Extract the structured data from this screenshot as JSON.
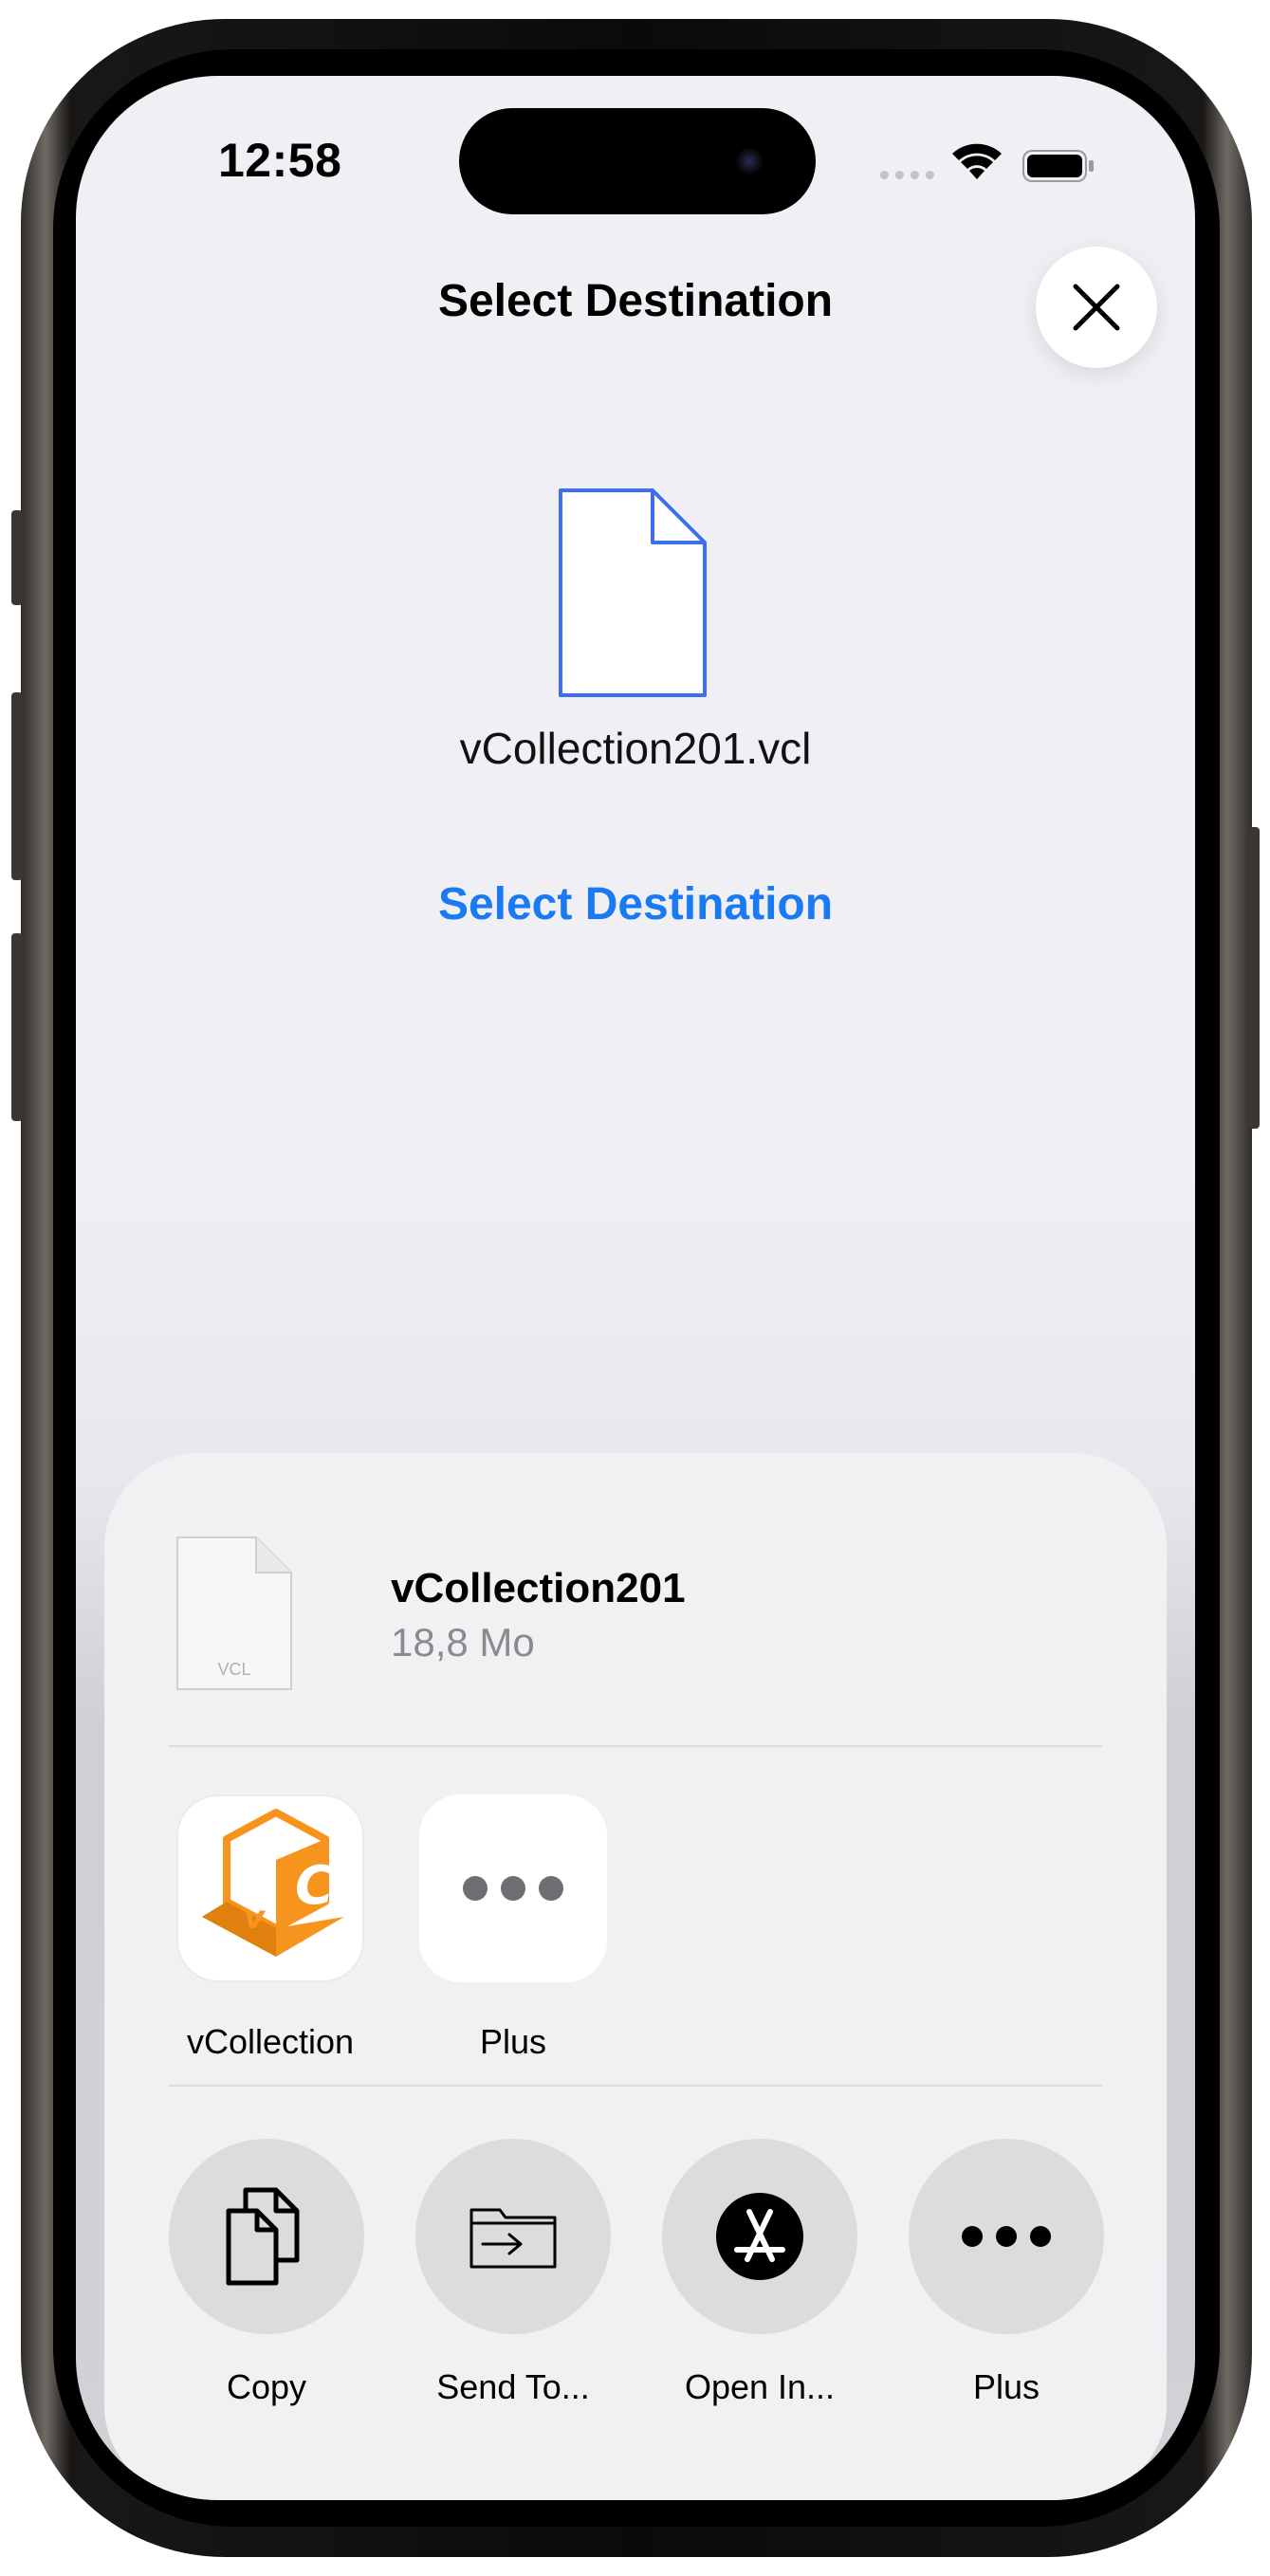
{
  "status_bar": {
    "time": "12:58"
  },
  "header": {
    "title": "Select Destination",
    "close_icon": "close-icon"
  },
  "file": {
    "name": "vCollection201.vcl",
    "select_destination_label": "Select Destination"
  },
  "share_sheet": {
    "document": {
      "name": "vCollection201",
      "size": "18,8 Mo",
      "thumb_label": "VCL"
    },
    "apps": [
      {
        "label": "vCollection",
        "icon": "vcollection-app-icon",
        "brand_color": "#f7941d"
      },
      {
        "label": "Plus",
        "icon": "more-icon"
      }
    ],
    "actions": [
      {
        "label": "Copy",
        "icon": "copy-icon"
      },
      {
        "label": "Send To...",
        "icon": "send-to-folder-icon"
      },
      {
        "label": "Open In...",
        "icon": "app-store-icon"
      },
      {
        "label": "Plus",
        "icon": "more-icon"
      }
    ]
  },
  "colors": {
    "accent": "#1a7af2",
    "background": "#efeff4",
    "sheet": "#f1f1f4"
  }
}
